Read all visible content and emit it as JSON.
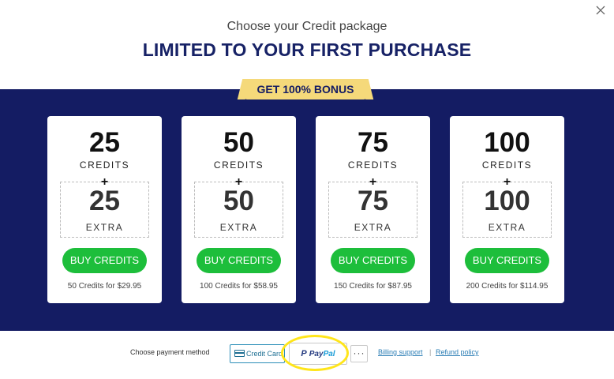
{
  "header": {
    "subtitle": "Choose your Credit package",
    "title": "LIMITED TO YOUR FIRST PURCHASE",
    "close_icon": "close-icon"
  },
  "bonus_label": "GET 100% BONUS",
  "colors": {
    "band": "#141c63",
    "title": "#172266",
    "bonus": "#f5d97a",
    "buy_button": "#1dbe3b",
    "highlight": "#ffe51a"
  },
  "packages": [
    {
      "credits": "25",
      "credits_label": "CREDITS",
      "plus": "+",
      "extra": "25",
      "extra_label": "EXTRA",
      "button": "BUY CREDITS",
      "price": "50 Credits for $29.95"
    },
    {
      "credits": "50",
      "credits_label": "CREDITS",
      "plus": "+",
      "extra": "50",
      "extra_label": "EXTRA",
      "button": "BUY CREDITS",
      "price": "100 Credits for $58.95"
    },
    {
      "credits": "75",
      "credits_label": "CREDITS",
      "plus": "+",
      "extra": "75",
      "extra_label": "EXTRA",
      "button": "BUY CREDITS",
      "price": "150 Credits for $87.95"
    },
    {
      "credits": "100",
      "credits_label": "CREDITS",
      "plus": "+",
      "extra": "100",
      "extra_label": "EXTRA",
      "button": "BUY CREDITS",
      "price": "200 Credits for $114.95"
    }
  ],
  "payment": {
    "label": "Choose payment method",
    "credit_card": "Credit Card",
    "paypal_p": "P",
    "paypal_pay": "Pay",
    "paypal_pal": "Pal",
    "more": "···",
    "billing_support": "Billing support",
    "separator": "|",
    "refund_policy": "Refund policy"
  }
}
